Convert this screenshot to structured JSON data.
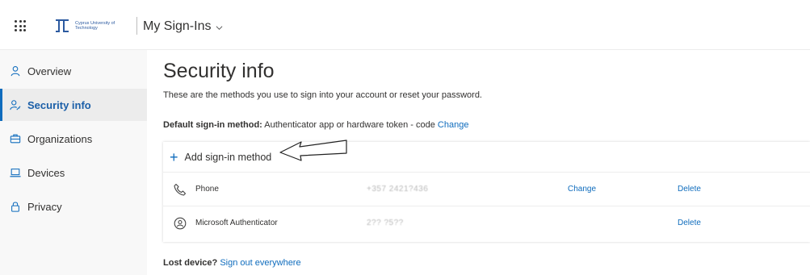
{
  "header": {
    "logo_text": "Cyprus University of Technology",
    "app_title": "My Sign-Ins"
  },
  "sidebar": {
    "items": [
      {
        "label": "Overview",
        "icon": "person-icon"
      },
      {
        "label": "Security info",
        "icon": "key-person-icon"
      },
      {
        "label": "Organizations",
        "icon": "briefcase-icon"
      },
      {
        "label": "Devices",
        "icon": "laptop-icon"
      },
      {
        "label": "Privacy",
        "icon": "lock-icon"
      }
    ],
    "active": "Security info"
  },
  "main": {
    "title": "Security info",
    "subtitle": "These are the methods you use to sign into your account or reset your password.",
    "default_method_label": "Default sign-in method:",
    "default_method_value": "Authenticator app or hardware token - code",
    "default_method_change": "Change",
    "add_method_label": "Add sign-in method",
    "methods": [
      {
        "name": "Phone",
        "icon": "phone-icon",
        "value": "+357 2421?436",
        "change": "Change",
        "delete": "Delete"
      },
      {
        "name": "Microsoft Authenticator",
        "icon": "authenticator-icon",
        "value": "2?? ?5??",
        "change": "",
        "delete": "Delete"
      }
    ],
    "lost_device_label": "Lost device?",
    "lost_device_link": "Sign out everywhere"
  },
  "colors": {
    "accent": "#0f6cbd",
    "sidebar_bg": "#f8f8f8",
    "active_bg": "#ececec"
  }
}
